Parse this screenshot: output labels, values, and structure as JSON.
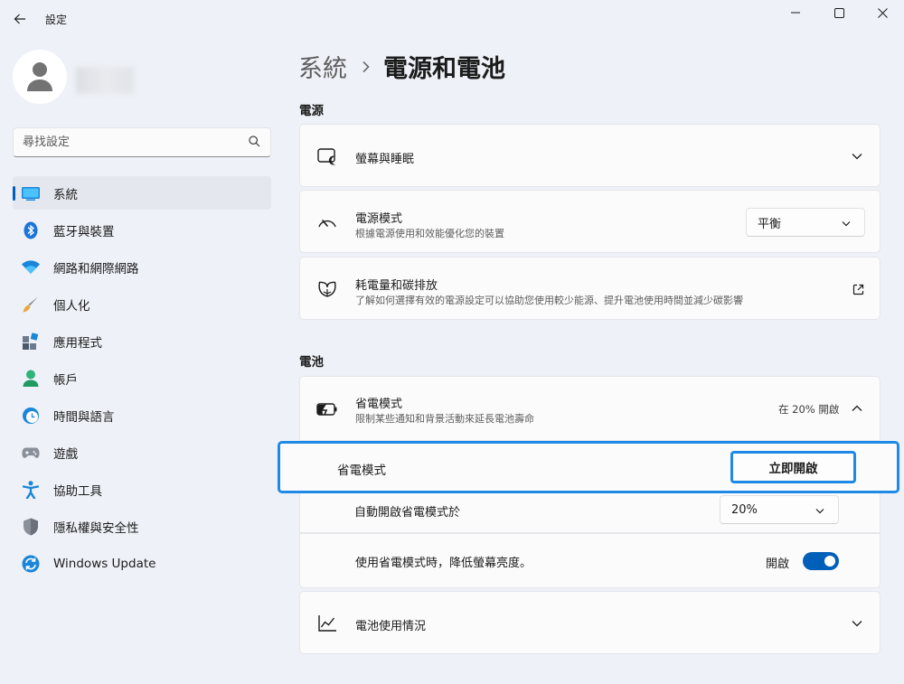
{
  "window": {
    "title": "設定"
  },
  "sidebar": {
    "search_placeholder": "尋找設定",
    "items": [
      {
        "label": "系統",
        "icon": "display-icon",
        "active": true
      },
      {
        "label": "藍牙與裝置",
        "icon": "bluetooth-icon"
      },
      {
        "label": "網路和網際網路",
        "icon": "wifi-icon"
      },
      {
        "label": "個人化",
        "icon": "paintbrush-icon"
      },
      {
        "label": "應用程式",
        "icon": "apps-icon"
      },
      {
        "label": "帳戶",
        "icon": "account-icon"
      },
      {
        "label": "時間與語言",
        "icon": "clock-globe-icon"
      },
      {
        "label": "遊戲",
        "icon": "gamepad-icon"
      },
      {
        "label": "協助工具",
        "icon": "accessibility-icon"
      },
      {
        "label": "隱私權與安全性",
        "icon": "shield-icon"
      },
      {
        "label": "Windows Update",
        "icon": "update-icon"
      }
    ]
  },
  "header": {
    "parent": "系統",
    "current": "電源和電池"
  },
  "power": {
    "section_title": "電源",
    "screen_sleep": {
      "title": "螢幕與睡眠"
    },
    "power_mode": {
      "title": "電源模式",
      "desc": "根據電源使用和效能優化您的裝置",
      "value": "平衡"
    },
    "energy": {
      "title": "耗電量和碳排放",
      "desc": "了解如何選擇有效的電源設定可以協助您使用較少能源、提升電池使用時間並減少碳影響"
    }
  },
  "battery": {
    "section_title": "電池",
    "saver": {
      "title": "省電模式",
      "desc": "限制某些通知和背景活動來延長電池壽命",
      "status": "在 20% 開啟"
    },
    "saver_now": {
      "label": "省電模式",
      "button": "立即開啟"
    },
    "auto_on": {
      "label": "自動開啟省電模式於",
      "value": "20%"
    },
    "dim": {
      "label": "使用省電模式時，降低螢幕亮度。",
      "state": "開啟",
      "on": true
    },
    "usage": {
      "title": "電池使用情況"
    }
  },
  "colors": {
    "accent": "#005fb8",
    "highlight": "#1e8ae6"
  }
}
